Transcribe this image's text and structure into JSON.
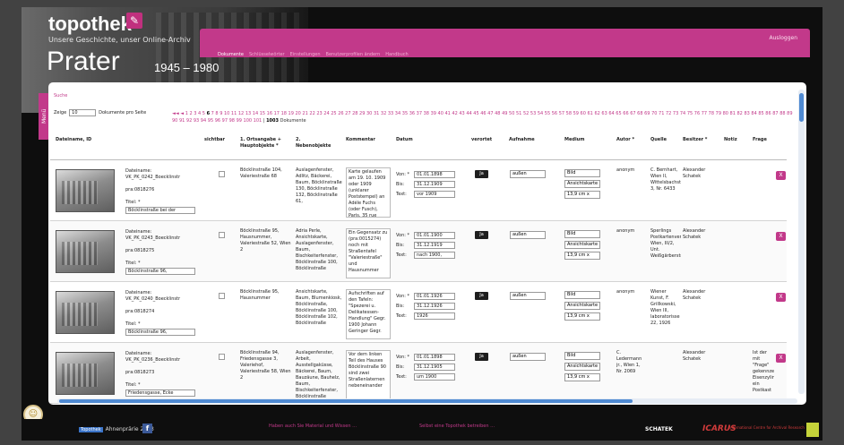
{
  "brand": {
    "logo": "topothek",
    "tagline": "Unsere Geschichte, unser Online-Archiv",
    "title": "Prater",
    "years": "1945 – 1980"
  },
  "header": {
    "logout": "Ausloggen",
    "nav": [
      "Dokumente",
      "Schlüsselwörter",
      "Einstellungen",
      "Benutzerprofilen ändern",
      "Handbuch"
    ]
  },
  "menu_tab": "Menü",
  "search_link": "Suche",
  "pager": {
    "show_label": "Zeige",
    "per_page": "10",
    "per_page_suffix": "Dokumente pro Seite",
    "arrows": "◄◄ ◄",
    "pages_before": "1 2 3 4 5",
    "current": "6",
    "pages_after": "7 8 9 10 11 12 13 14 15 16 17 18 19 20 21 22 23 24 25 26 27 28 29 30 31 32 33 34 35 36 37 38 39 40 41 42 43 44 45 46 47 48 49 50 51 52 53 54 55 56 57 58 59 60 61 62 63 64 65 66 67 68 69 70 71 72 73 74 75 76 77 78 79 80 81 82 83 84 85 86 87 88 89 90 91 92 93 94 95 96 97 98 99 100 101",
    "total": "1003",
    "total_suffix": "Dokumente"
  },
  "columns": [
    "Dateiname, ID",
    "sichtbar",
    "1. Ortsangabe + Hauptobjekte *",
    "2. Nebenobjekte",
    "Kommentar",
    "Datum",
    "verortet",
    "Aufnahme",
    "Medium",
    "Autor *",
    "Quelle",
    "Besitzer *",
    "Notiz",
    "Frage"
  ],
  "row_labels": {
    "dateiname": "Dateiname:",
    "titel": "Titel: *",
    "von": "Von: *",
    "bis": "Bis:",
    "text": "Text:",
    "ja": "Ja",
    "x": "X"
  },
  "rows": [
    {
      "file": "VK_PK_0242_Boecklinstr",
      "id": "pra:0818276",
      "title": "Böcklinstraße bei der",
      "ort": "Böcklinstraße 104, Valeriestraße 68",
      "neben": "Auslagenfenster, Adlitz, Bäckerei, Baum, Böcklinstraße 130, Böcklinstraße 132, Böcklinstraße 61,",
      "kommentar": "Karte gelaufen am 19. 10. 1909 oder 1909 (unklarer Poststempel) an Adéle Fuchs (oder Fusch), Paris, 35 rue",
      "von": "01.01.1898",
      "bis": "31.12.1909",
      "text": "vor 1909",
      "aufnahme": "außen",
      "medium": "Bild",
      "medium2": "Ansichtskarte",
      "size": "13,9 cm x",
      "autor": "anonym",
      "quelle": "C. Bernhart, Wien II, Wittelsbachstrasse 3, Nr. 6433",
      "besitzer": "Alexander Schatek",
      "frage": ""
    },
    {
      "file": "VK_PK_0243_Boecklinstr",
      "id": "pra:0818275",
      "title": "Böcklinstraße 96,",
      "ort": "Böcklinstraße 95, Hausnummer, Valeriestraße 52, Wien 2",
      "neben": "Adria Perle, Ansichtskarte, Auslagenfenster, Baum, Bischkeiterfenster, Böcklinstraße 100, Böcklinstraße",
      "kommentar": "Ein Gegensatz zu (pra:0015274) noch mit Straßentafel \"Valeriestraße\" und Hausnummer",
      "von": "01.01.1900",
      "bis": "31.12.1919",
      "text": "nach 1900,",
      "aufnahme": "außen",
      "medium": "Bild",
      "medium2": "Ansichtskarte",
      "size": "13,9 cm x",
      "autor": "anonym",
      "quelle": "Sperlings Postkartenverlag, Wien, III/2, Unt. Weißgärberstraße",
      "besitzer": "Alexander Schatek",
      "frage": ""
    },
    {
      "file": "VK_PK_0240_Boecklinstr",
      "id": "pra:0818274",
      "title": "Böcklinstraße 96,",
      "ort": "Böcklinstraße 95, Hausnummer",
      "neben": "Ansichtskarte, Baum, Blumenkiosk, Böcklinstraße, Böcklinstraße 100, Böcklinstraße 102, Böcklinstraße",
      "kommentar": "Aufschriften auf den Tafeln: \"Spezerei u. Delikatessen-Handlung\" Gegr. 1900 Johann Geringer Gegr.",
      "von": "01.01.1926",
      "bis": "31.12.1926",
      "text": "1926",
      "aufnahme": "außen",
      "medium": "Bild",
      "medium2": "Ansichtskarte",
      "size": "13,9 cm x",
      "autor": "anonym",
      "quelle": "Wiener Kunst, F. Grillkowski, Wien III, laboratorisse 22, 1926",
      "besitzer": "Alexander Schatek",
      "frage": ""
    },
    {
      "file": "VK_PK_0236_Boecklinstr",
      "id": "pra:0818273",
      "title": "Friedensgasse, Ecke",
      "ort": "Böcklinstraße 94, Friedensgasse 3, Valeriehof, Valeriestraße 58, Wien 2",
      "neben": "Auslagenfenster, Arbeit, Ausstellgaküsse, Bäckerei, Baum, Bauzäune, Bauhelz, Baum, Bischkeiterfenster, Böcklinstraße",
      "kommentar": "Vor dem linken Teil des Hauses Böcklinstraße 90 sind zwei Straßenlaternen nebeneinander",
      "von": "01.01.1898",
      "bis": "31.12.1905",
      "text": "um 1900",
      "aufnahme": "außen",
      "medium": "Bild",
      "medium2": "Ansichtskarte",
      "size": "13,9 cm x",
      "autor": "C. Ledermann jr., Wien 1, Nr. 2069",
      "quelle": "",
      "besitzer": "Alexander Schatek",
      "frage": "Ist der mit \"Frage\" gekennzeichnete Eisenzylinder ein Postkast"
    }
  ],
  "footer": {
    "copyright": "Ahnenprärie 2013",
    "copyright_box": "Topothek",
    "link1": "Haben auch Sie Material und Wissen …",
    "link2": "Selbst eine Topothek betreiben …",
    "sponsor1": "SCHATEK",
    "sponsor2": "ICARUS",
    "sponsor2_sub": "International Centre for Archival Research"
  },
  "colors": {
    "accent": "#c2398a",
    "bg": "#424242",
    "scroll": "#4f8ad2"
  }
}
